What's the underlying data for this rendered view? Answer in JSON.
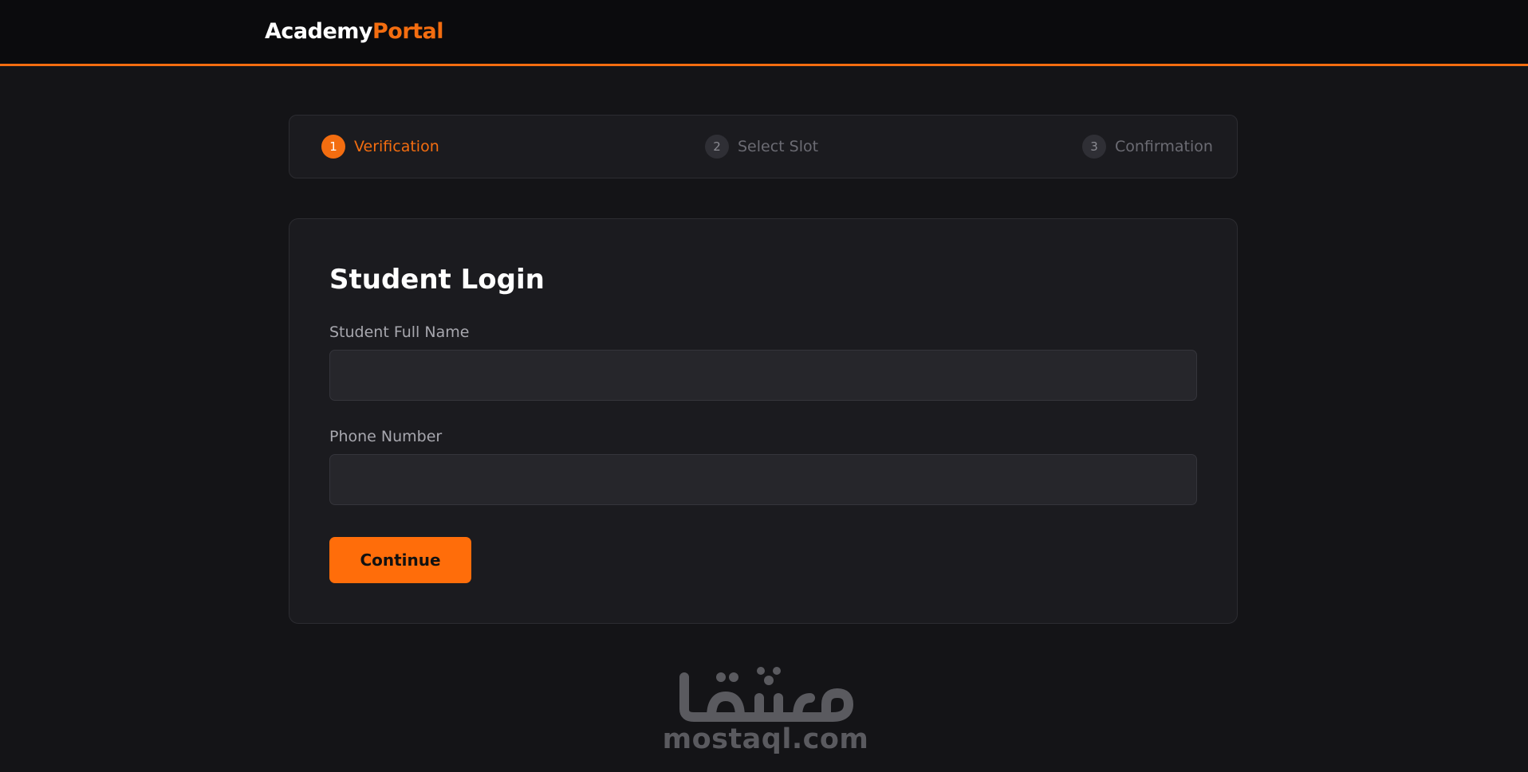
{
  "header": {
    "brand_part1": "Academy",
    "brand_part2": "Portal",
    "accent_color": "#f36d10"
  },
  "stepper": {
    "steps": [
      {
        "number": "1",
        "label": "Verification",
        "state": "active"
      },
      {
        "number": "2",
        "label": "Select Slot",
        "state": "inactive"
      },
      {
        "number": "3",
        "label": "Confirmation",
        "state": "inactive"
      }
    ]
  },
  "form": {
    "title": "Student Login",
    "name_label": "Student Full Name",
    "name_value": "",
    "name_placeholder": "",
    "phone_label": "Phone Number",
    "phone_value": "",
    "phone_placeholder": "",
    "submit_label": "Continue"
  },
  "watermark": {
    "arabic_logo": "مستقل",
    "domain": "mostaql.com",
    "color": "#5a5a5f"
  }
}
